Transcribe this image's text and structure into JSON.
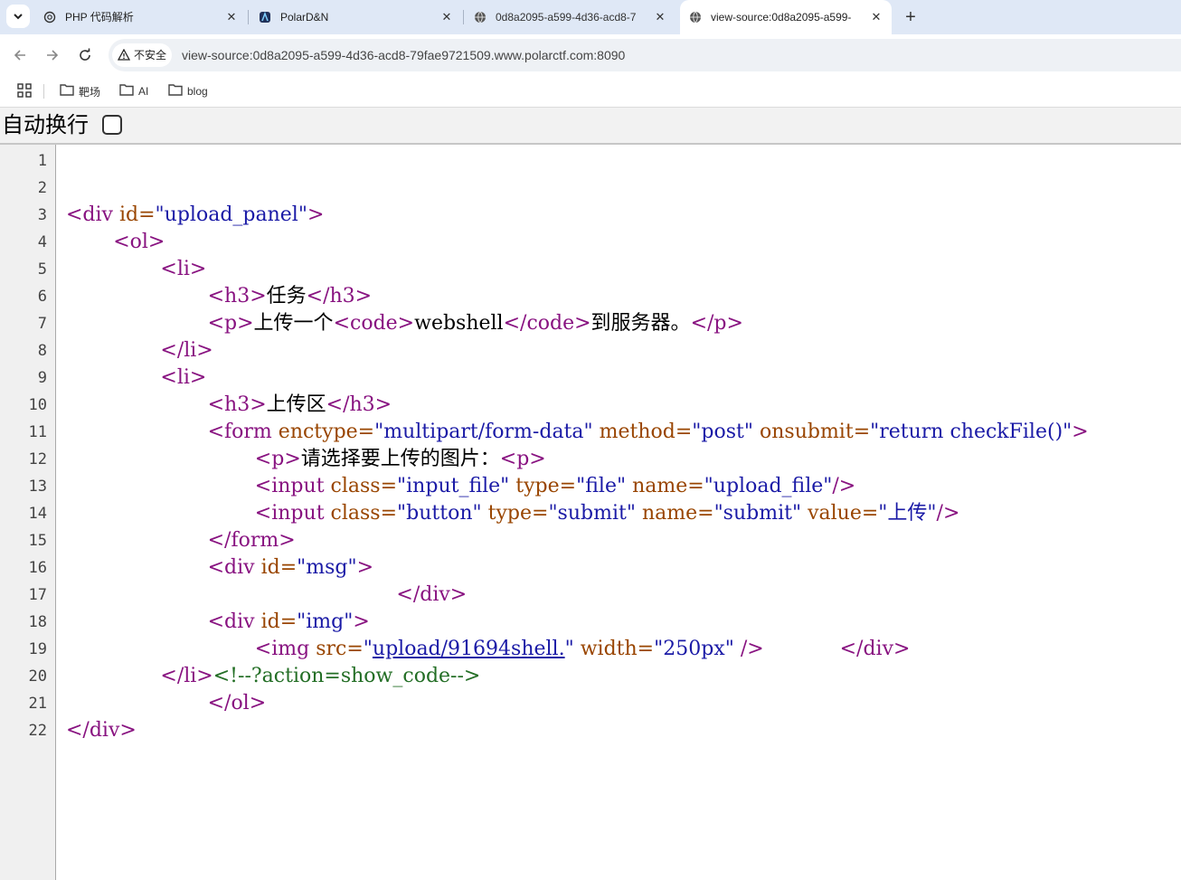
{
  "tabs": [
    {
      "title": "PHP 代码解析",
      "icon": "openai-icon",
      "active": false
    },
    {
      "title": "PolarD&N",
      "icon": "polar-logo-icon",
      "active": false
    },
    {
      "title": "0d8a2095-a599-4d36-acd8-7",
      "icon": "globe-icon",
      "active": false
    },
    {
      "title": "view-source:0d8a2095-a599-",
      "icon": "globe-icon",
      "active": true
    }
  ],
  "address_bar": {
    "security_label": "不安全",
    "url": "view-source:0d8a2095-a599-4d36-acd8-79fae9721509.www.polarctf.com:8090"
  },
  "bookmarks": [
    {
      "label": "靶场"
    },
    {
      "label": "AI"
    },
    {
      "label": "blog"
    }
  ],
  "wrap_toggle": {
    "label": "自动换行",
    "checked": false
  },
  "source_lines": [
    {
      "n": "1",
      "indent": 0,
      "segs": []
    },
    {
      "n": "2",
      "indent": 0,
      "segs": []
    },
    {
      "n": "3",
      "indent": 0,
      "segs": [
        [
          "tg",
          "<div "
        ],
        [
          "at",
          "id="
        ],
        [
          "av",
          "\"upload_panel\""
        ],
        [
          "tg",
          ">"
        ]
      ]
    },
    {
      "n": "4",
      "indent": 4,
      "segs": [
        [
          "tg",
          "<ol>"
        ]
      ]
    },
    {
      "n": "5",
      "indent": 8,
      "segs": [
        [
          "tg",
          "<li>"
        ]
      ]
    },
    {
      "n": "6",
      "indent": 12,
      "segs": [
        [
          "tg",
          "<h3>"
        ],
        [
          "tx",
          "任务"
        ],
        [
          "tg",
          "</h3>"
        ]
      ]
    },
    {
      "n": "7",
      "indent": 12,
      "segs": [
        [
          "tg",
          "<p>"
        ],
        [
          "tx",
          "上传一个"
        ],
        [
          "tg",
          "<code>"
        ],
        [
          "tx",
          "webshell"
        ],
        [
          "tg",
          "</code>"
        ],
        [
          "tx",
          "到服务器。"
        ],
        [
          "tg",
          "</p>"
        ]
      ]
    },
    {
      "n": "8",
      "indent": 8,
      "segs": [
        [
          "tg",
          "</li>"
        ]
      ]
    },
    {
      "n": "9",
      "indent": 8,
      "segs": [
        [
          "tg",
          "<li>"
        ]
      ]
    },
    {
      "n": "10",
      "indent": 12,
      "segs": [
        [
          "tg",
          "<h3>"
        ],
        [
          "tx",
          "上传区"
        ],
        [
          "tg",
          "</h3>"
        ]
      ]
    },
    {
      "n": "11",
      "indent": 12,
      "segs": [
        [
          "tg",
          "<form "
        ],
        [
          "at",
          "enctype="
        ],
        [
          "av",
          "\"multipart/form-data\""
        ],
        [
          "at",
          " method="
        ],
        [
          "av",
          "\"post\""
        ],
        [
          "at",
          " onsubmit="
        ],
        [
          "av",
          "\"return checkFile()\""
        ],
        [
          "tg",
          ">"
        ]
      ]
    },
    {
      "n": "12",
      "indent": 16,
      "segs": [
        [
          "tg",
          "<p>"
        ],
        [
          "tx",
          "请选择要上传的图片："
        ],
        [
          "tg",
          "<p>"
        ]
      ]
    },
    {
      "n": "13",
      "indent": 16,
      "segs": [
        [
          "tg",
          "<input "
        ],
        [
          "at",
          "class="
        ],
        [
          "av",
          "\"input_file\""
        ],
        [
          "at",
          " type="
        ],
        [
          "av",
          "\"file\""
        ],
        [
          "at",
          " name="
        ],
        [
          "av",
          "\"upload_file\""
        ],
        [
          "tg",
          "/>"
        ]
      ]
    },
    {
      "n": "14",
      "indent": 16,
      "segs": [
        [
          "tg",
          "<input "
        ],
        [
          "at",
          "class="
        ],
        [
          "av",
          "\"button\""
        ],
        [
          "at",
          " type="
        ],
        [
          "av",
          "\"submit\""
        ],
        [
          "at",
          " name="
        ],
        [
          "av",
          "\"submit\""
        ],
        [
          "at",
          " value="
        ],
        [
          "av",
          "\"上传\""
        ],
        [
          "tg",
          "/>"
        ]
      ]
    },
    {
      "n": "15",
      "indent": 12,
      "segs": [
        [
          "tg",
          "</form>"
        ]
      ]
    },
    {
      "n": "16",
      "indent": 12,
      "segs": [
        [
          "tg",
          "<div "
        ],
        [
          "at",
          "id="
        ],
        [
          "av",
          "\"msg\""
        ],
        [
          "tg",
          ">"
        ]
      ]
    },
    {
      "n": "17",
      "indent": 28,
      "segs": [
        [
          "tg",
          "</div>"
        ]
      ]
    },
    {
      "n": "18",
      "indent": 12,
      "segs": [
        [
          "tg",
          "<div "
        ],
        [
          "at",
          "id="
        ],
        [
          "av",
          "\"img\""
        ],
        [
          "tg",
          ">"
        ]
      ]
    },
    {
      "n": "19",
      "indent": 16,
      "segs": [
        [
          "tg",
          "<img "
        ],
        [
          "at",
          "src="
        ],
        [
          "av",
          "\""
        ],
        [
          "lk",
          "upload/91694shell."
        ],
        [
          "av",
          "\""
        ],
        [
          "at",
          " width="
        ],
        [
          "av",
          "\"250px\""
        ],
        [
          "tg",
          " />"
        ],
        [
          "tx",
          "            "
        ],
        [
          "tg",
          "</div>"
        ]
      ]
    },
    {
      "n": "20",
      "indent": 8,
      "segs": [
        [
          "tg",
          "</li>"
        ],
        [
          "cm",
          "<!--?action=show_code-->"
        ]
      ]
    },
    {
      "n": "21",
      "indent": 12,
      "segs": [
        [
          "tg",
          "</ol>"
        ]
      ]
    },
    {
      "n": "22",
      "indent": 0,
      "segs": [
        [
          "tg",
          "</div>"
        ]
      ]
    }
  ]
}
